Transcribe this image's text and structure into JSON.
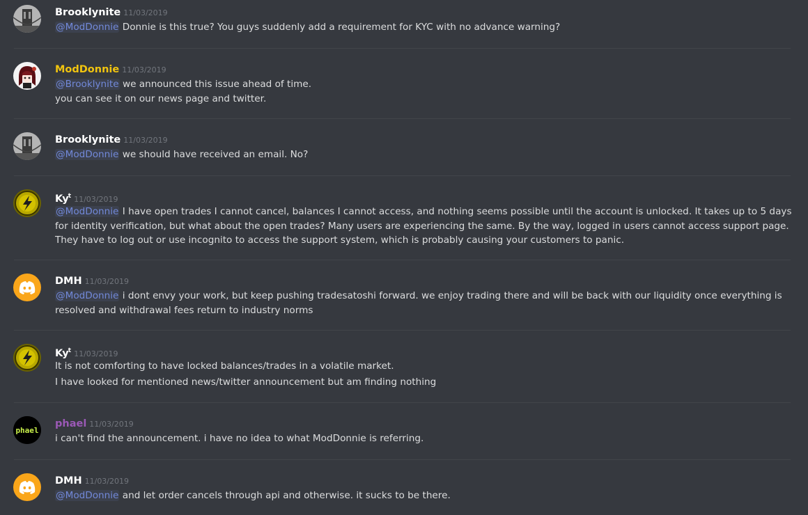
{
  "messages": [
    {
      "author": "Brooklynite",
      "timestamp": "11/03/2019",
      "avatar": "bridge-photo-avatar",
      "lines": [
        {
          "mention": "@ModDonnie",
          "text": " Donnie is this true? You guys suddenly  add a requirement for KYC with no advance warning?"
        }
      ]
    },
    {
      "author": "ModDonnie",
      "timestamp": "11/03/2019",
      "avatar": "anime-character-avatar",
      "author_color": "#f1c40f",
      "lines": [
        {
          "mention": "@Brooklynite",
          "text": " we announced this issue ahead of time."
        },
        {
          "text": "you can see it on our news page and twitter."
        }
      ]
    },
    {
      "author": "Brooklynite",
      "timestamp": "11/03/2019",
      "avatar": "bridge-photo-avatar",
      "lines": [
        {
          "mention": "@ModDonnie",
          "text": " we should have received an email. No?"
        }
      ]
    },
    {
      "author": "Ky",
      "author_sup": "t",
      "timestamp": "11/03/2019",
      "avatar": "lightning-logo-avatar",
      "lines": [
        {
          "mention": "@ModDonnie",
          "text": " I have open trades I cannot cancel, balances I cannot access, and nothing seems possible until the account is unlocked. It takes up to 5 days for identity verification, but what about the open trades? Many users are experiencing the same. By the way, logged in users cannot access support page. They have to log out or use incognito to access the support system, which is probably causing your customers to panic."
        }
      ]
    },
    {
      "author": "DMH",
      "timestamp": "11/03/2019",
      "avatar": "discord-logo-avatar",
      "lines": [
        {
          "mention": "@ModDonnie",
          "text": " i dont envy your work, but keep pushing tradesatoshi forward. we enjoy trading there and will be back with our liquidity once everything is resolved and withdrawal fees return to industry norms"
        }
      ]
    },
    {
      "author": "Ky",
      "author_sup": "t",
      "timestamp": "11/03/2019",
      "avatar": "lightning-logo-avatar",
      "lines": [
        {
          "text": "It is not comforting to have locked balances/trades in a volatile market."
        },
        {
          "text": "I have looked for mentioned news/twitter announcement but am finding nothing"
        }
      ]
    },
    {
      "author": "phael",
      "timestamp": "11/03/2019",
      "avatar": "phael-text-avatar",
      "avatar_text": "phael",
      "author_color": "#9b59b6",
      "lines": [
        {
          "text": "i can't find the announcement. i have no idea to what ModDonnie is referring."
        }
      ]
    },
    {
      "author": "DMH",
      "timestamp": "11/03/2019",
      "avatar": "discord-logo-avatar",
      "lines": [
        {
          "mention": "@ModDonnie",
          "text": " and let order cancels through api and otherwise. it sucks to be there."
        }
      ]
    }
  ]
}
